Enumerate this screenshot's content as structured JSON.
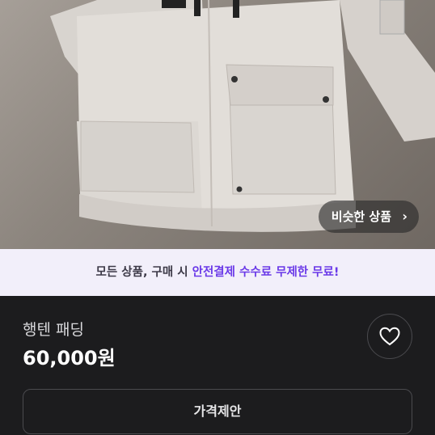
{
  "product_photo": {
    "similar_button_label": "비슷한 상품",
    "similar_button_icon": "chevron-right-icon"
  },
  "promo_banner": {
    "text_plain": "모든 상품, 구매 시 ",
    "text_highlight": "안전결제 수수료 무제한 무료!",
    "highlight_color": "#6a39e8"
  },
  "listing": {
    "title": "행텐 패딩",
    "price": "60,000원",
    "like_icon": "heart-outline-icon",
    "offer_button_label": "가격제안"
  }
}
